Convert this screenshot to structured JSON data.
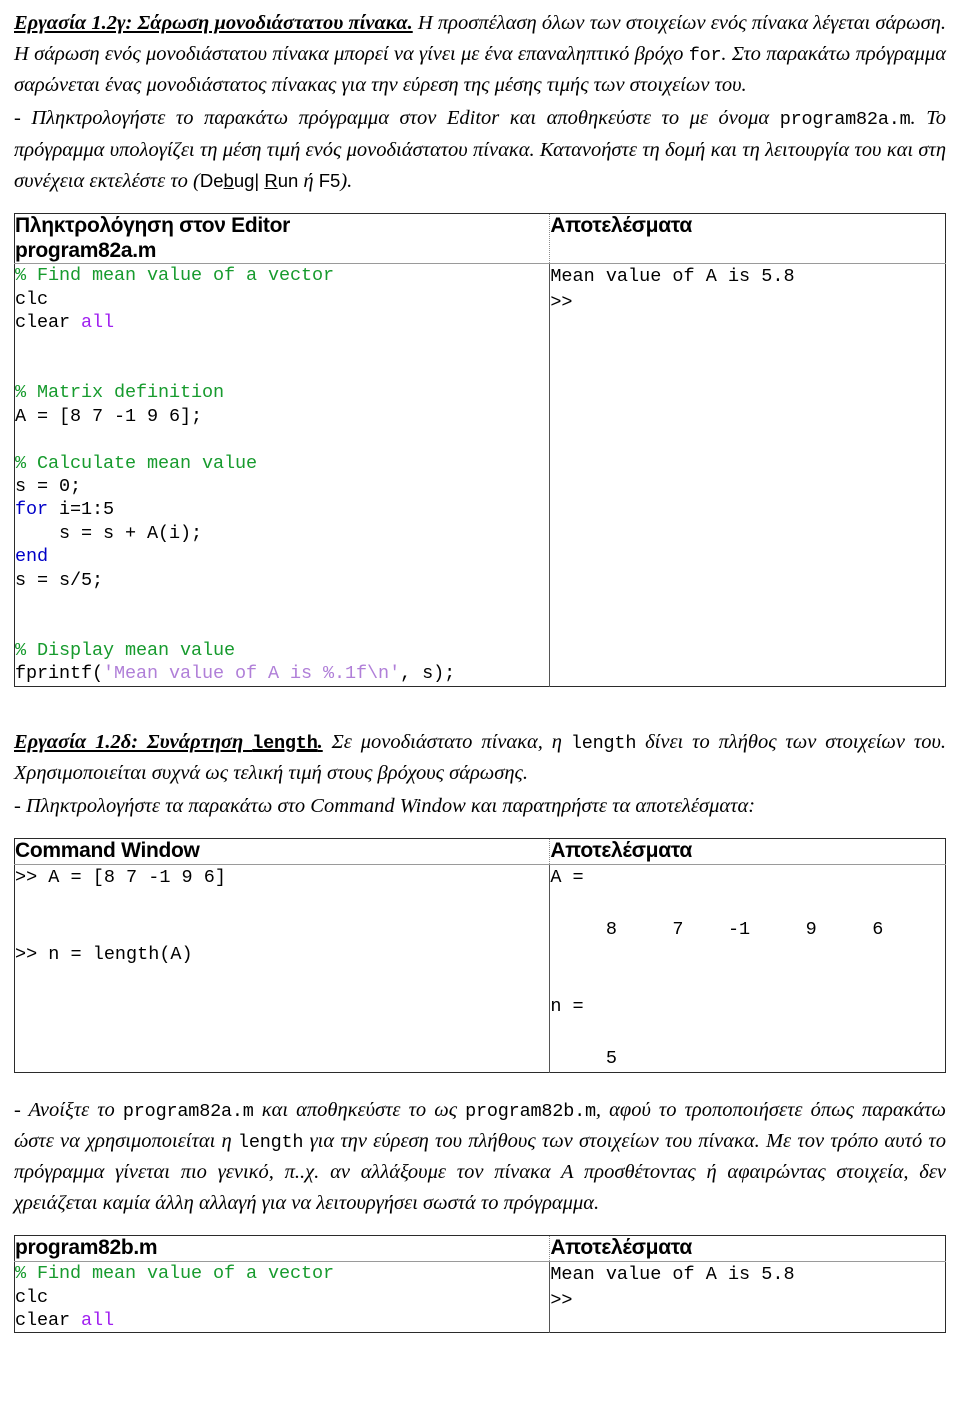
{
  "document": {
    "section1": {
      "heading": "Εργασία 1.2γ: Σάρωση μονοδιάστατου πίνακα.",
      "par1_a": " Η προσπέλαση όλων των στοιχείων ενός πίνακα λέγεται σάρωση. Η σάρωση ενός μονοδιάστατου πίνακα μπορεί να γίνει με ένα επαναληπτικό βρόχο ",
      "par1_mono1": "for",
      "par1_b": ". Στο παρακάτω πρόγραμμα σαρώνεται ένας μονοδιάστατος πίνακας για την εύρεση της μέσης τιμής των στοιχείων του.",
      "par2_a": "- Πληκτρολογήστε το παρακάτω πρόγραμμα στον Editor και αποθηκεύστε το με όνομα ",
      "par2_mono1": "program82a.m",
      "par2_b": ". Το πρόγραμμα υπολογίζει τη μέση τιμή ενός μονοδιάστατου πίνακα. Κατανοήστε τη δομή και τη λειτουργία του και στη συνέχεια  εκτελέστε το (",
      "par2_menu_pre": "De",
      "par2_menu_mn1": "b",
      "par2_menu_mid": "ug| ",
      "par2_menu_mn2": "R",
      "par2_menu_post": "un",
      "par2_c": " ή  ",
      "par2_key": "F5",
      "par2_d": ")."
    },
    "table1": {
      "header_left": "Πληκτρολόγηση στον Editor\nprogram82a.m",
      "header_right": "Αποτελέσματα",
      "code": [
        {
          "text": "% Find mean value of a vector",
          "cls": "c-comment"
        },
        {
          "text": "clc",
          "cls": ""
        },
        {
          "text": "clear ",
          "cls": ""
        },
        {
          "text": "all",
          "cls": "c-ident"
        },
        {
          "text": "",
          "cls": ""
        },
        {
          "text": "",
          "cls": ""
        },
        {
          "text": "% Matrix definition",
          "cls": "c-comment"
        },
        {
          "text": "A = [8 7 -1 9 6];",
          "cls": ""
        },
        {
          "text": "",
          "cls": ""
        },
        {
          "text": "% Calculate mean value",
          "cls": "c-comment"
        },
        {
          "text": "s = 0;",
          "cls": ""
        },
        {
          "text": "for",
          "cls": "c-keyword"
        },
        {
          "text": " i=1:5",
          "cls": ""
        },
        {
          "text": "    s = s + A(i);",
          "cls": ""
        },
        {
          "text": "end",
          "cls": "c-keyword"
        },
        {
          "text": "s = s/5;",
          "cls": ""
        },
        {
          "text": "",
          "cls": ""
        },
        {
          "text": "% Display mean value",
          "cls": "c-comment"
        },
        {
          "text": "fprintf(",
          "cls": ""
        },
        {
          "text": "'Mean value of A is %.1f\\n'",
          "cls": "c-string"
        },
        {
          "text": ", s);",
          "cls": ""
        }
      ],
      "code_plain": "% Find mean value of a vector\nclc\nclear all\n\n\n% Matrix definition\nA = [8 7 -1 9 6];\n\n% Calculate mean value\ns = 0;\nfor i=1:5\n    s = s + A(i);\nend\ns = s/5;\n\n\n% Display mean value\nfprintf('Mean value of A is %.1f\\n', s);",
      "output": "Mean value of A is 5.8\n>>"
    },
    "section2": {
      "heading": "Εργασία 1.2δ: Συνάρτηση ",
      "heading_mono": "length",
      "heading_dot": ".",
      "par1_a": " Σε μονοδιάστατο πίνακα, η ",
      "par1_mono": "length",
      "par1_b": " δίνει το πλήθος των στοιχείων του. Χρησιμοποιείται συχνά ως τελική τιμή στους βρόχους σάρωσης.",
      "par2": "- Πληκτρολογήστε τα παρακάτω στο Command Window και παρατηρήστε τα αποτελέσματα:"
    },
    "table2": {
      "header_left": "Command Window",
      "header_right": "Αποτελέσματα",
      "rows": [
        {
          "command": ">> A = [8 7 -1 9 6]",
          "result": "A =\n\n     8     7    -1     9     6"
        },
        {
          "command": ">> n = length(A)",
          "result": "n =\n\n     5"
        }
      ],
      "commands_block": ">> A = [8 7 -1 9 6]\n\n\n>> n = length(A)",
      "results_block": "A =\n\n     8     7    -1     9     6\n\n\nn =\n\n     5"
    },
    "section3": {
      "par_a": "- Ανοίξτε το ",
      "par_mono1": "program82a.m",
      "par_b": " και αποθηκεύστε το ως ",
      "par_mono2": "program82b.m",
      "par_c": ", αφού το τροποποιήσετε όπως παρακάτω ώστε να χρησιμοποιείται η ",
      "par_mono3": "length",
      "par_d": " για την εύρεση του πλήθους των στοιχείων του πίνακα. Με τον τρόπο αυτό το πρόγραμμα γίνεται πιο γενικό, π..χ. αν αλλάξουμε τον πίνακα Α προσθέτοντας ή αφαιρώντας στοιχεία, δεν χρειάζεται καμία άλλη αλλαγή για να λειτουργήσει σωστά το πρόγραμμα."
    },
    "table3": {
      "header_left": "program82b.m",
      "header_right": "Αποτελέσματα",
      "code_plain": "% Find mean value of a vector\nclc\nclear all",
      "output": "Mean value of A is 5.8\n>>"
    }
  },
  "colors": {
    "comment": "#179b2e",
    "keyword": "#0000c8",
    "identifier": "#a020f0",
    "string": "#b07fd8",
    "border": "#2b2b2b",
    "text": "#000000"
  }
}
